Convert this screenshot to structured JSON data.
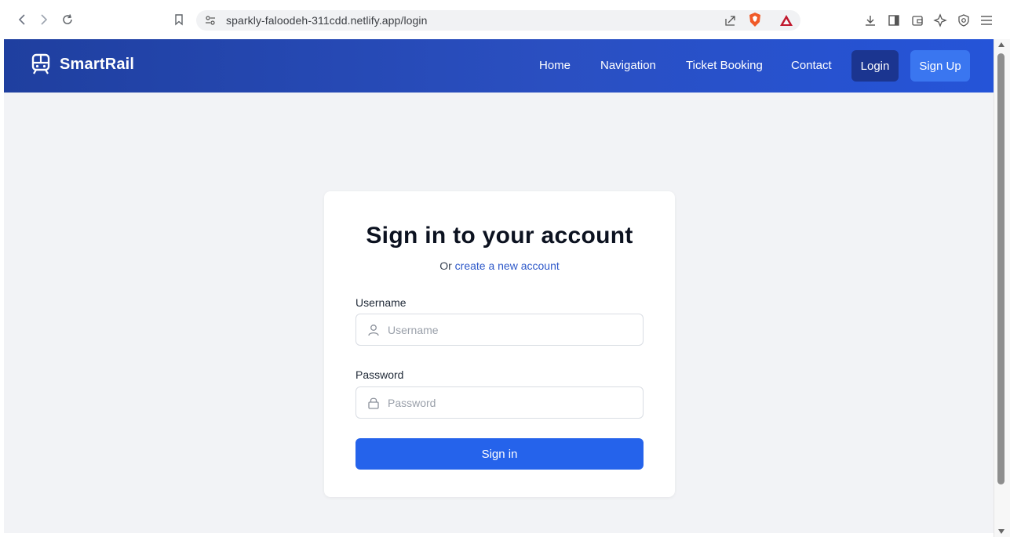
{
  "browser": {
    "url": "sparkly-faloodeh-311cdd.netlify.app/login",
    "icons": [
      "back-icon",
      "forward-icon",
      "reload-icon",
      "bookmark-icon",
      "site-settings-icon",
      "share-icon",
      "brave-shields-icon",
      "brave-rewards-icon",
      "download-icon",
      "sidebar-icon",
      "wallet-icon",
      "leo-icon",
      "vpn-icon",
      "menu-icon"
    ]
  },
  "header": {
    "brand": "SmartRail",
    "nav": {
      "home": "Home",
      "navigation": "Navigation",
      "ticket_booking": "Ticket Booking",
      "contact": "Contact",
      "login": "Login",
      "signup": "Sign Up"
    }
  },
  "login": {
    "title": "Sign in to your account",
    "subtitle_prefix": "Or ",
    "subtitle_link": "create a new account",
    "username_label": "Username",
    "username_placeholder": "Username",
    "password_label": "Password",
    "password_placeholder": "Password",
    "submit": "Sign in"
  },
  "colors": {
    "header_start": "#1f3f9f",
    "header_end": "#2554d8",
    "primary_button": "#2563eb",
    "link": "#2d58c9",
    "page_background": "#f2f3f6"
  }
}
